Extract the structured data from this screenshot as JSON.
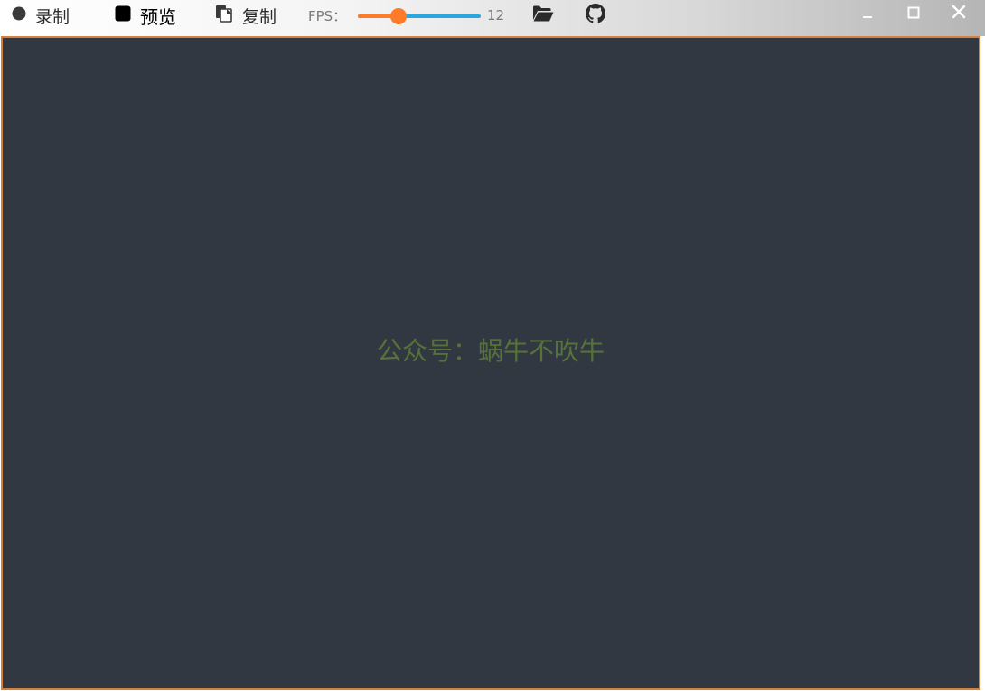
{
  "toolbar": {
    "record_label": "录制",
    "preview_label": "预览",
    "copy_label": "复制",
    "fps_label": "FPS：",
    "fps_value": "12",
    "fps_fraction": 0.33
  },
  "canvas": {
    "watermark": "公众号：蜗牛不吹牛"
  },
  "icons": {
    "record": "record-circle-icon",
    "preview": "stop-square-icon",
    "copy": "copy-icon",
    "folder": "folder-open-icon",
    "github": "github-icon",
    "minimize": "minimize-icon",
    "maximize": "maximize-icon",
    "close": "close-icon"
  },
  "colors": {
    "accent": "#ff7a29",
    "slider_track": "#2aa8de",
    "canvas_bg": "#313842",
    "canvas_border": "#d6803e",
    "watermark": "#56723a"
  }
}
